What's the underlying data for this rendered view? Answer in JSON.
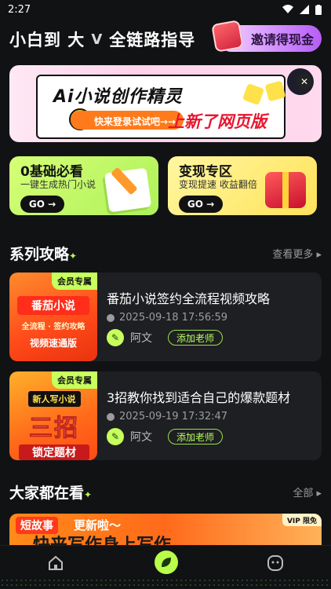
{
  "status_bar": {
    "time": "2:27"
  },
  "header": {
    "brand_left": "小白到 大",
    "brand_sep": "V",
    "brand_right": "全链路指导",
    "invite_label": "邀请得现金"
  },
  "banner": {
    "title": "Ai小说创作精灵",
    "try_label": "快来登录试试吧→→",
    "new_label": "上新了网页版",
    "close": "✕"
  },
  "quick": [
    {
      "title": "0基础必看",
      "subtitle": "一键生成热门小说",
      "go": "GO →"
    },
    {
      "title": "变现专区",
      "subtitle": "变现提速 收益翻倍",
      "go": "GO →"
    }
  ],
  "series": {
    "title": "系列攻略",
    "more": "查看更多 ▸",
    "articles": [
      {
        "vip": "会员专属",
        "thumb_lines": [
          "番茄小说",
          "全流程 · 签约攻略",
          "视频速通版"
        ],
        "title": "番茄小说签约全流程视频攻略",
        "time": "2025-09-18 17:56:59",
        "author": "阿文",
        "add_label": "添加老师"
      },
      {
        "vip": "会员专属",
        "thumb_lines": [
          "新人写小说",
          "三招",
          "锁定题材"
        ],
        "title": "3招教你找到适合自己的爆款题材",
        "time": "2025-09-19 17:32:47",
        "author": "阿文",
        "add_label": "添加老师"
      }
    ]
  },
  "everyone": {
    "title": "大家都在看",
    "more": "全部 ▸",
    "banner_tag": "短故事",
    "banner_text": "更新啦～",
    "banner_vip": "VIP 限免",
    "banner_bottom": "快来写作身上写作"
  },
  "tabs": {
    "home": "home-icon",
    "center": "leaf-icon",
    "profile": "smile-icon"
  }
}
